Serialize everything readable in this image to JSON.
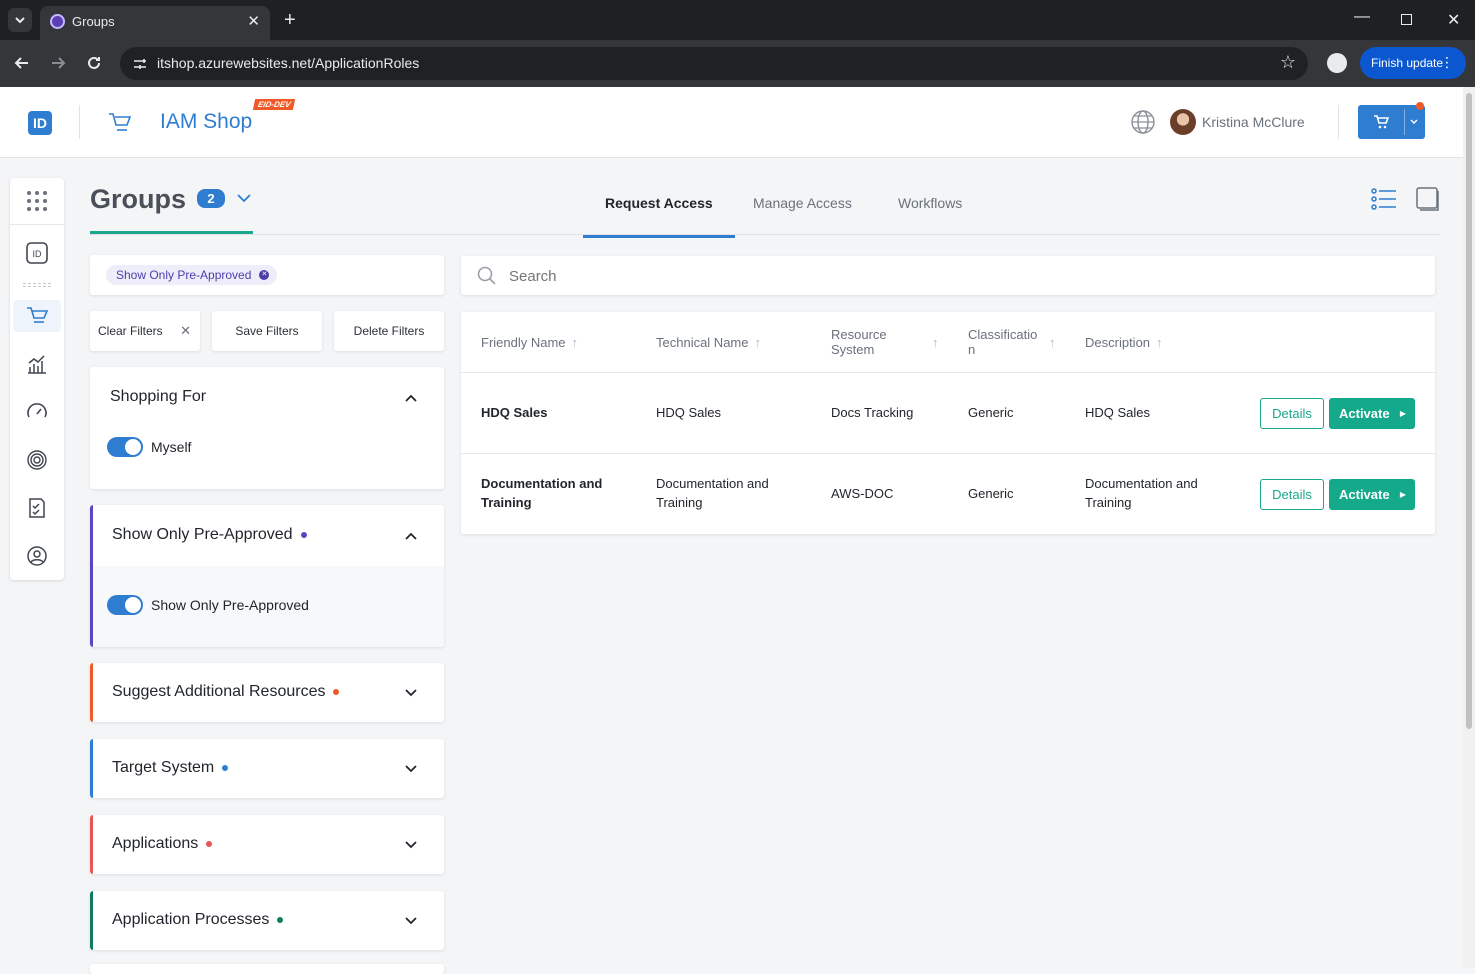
{
  "browser": {
    "tab_title": "Groups",
    "url": "itshop.azurewebsites.net/ApplicationRoles",
    "finish_update": "Finish update"
  },
  "header": {
    "logo_text": "ID",
    "app_name": "IAM Shop",
    "env_badge": "EID-DEV",
    "user_name": "Kristina McClure"
  },
  "page": {
    "title": "Groups",
    "count": "2",
    "tabs": [
      {
        "label": "Request Access",
        "active": true
      },
      {
        "label": "Manage Access",
        "active": false
      },
      {
        "label": "Workflows",
        "active": false
      }
    ]
  },
  "filters": {
    "active_chip": "Show Only Pre-Approved",
    "clear_label": "Clear Filters",
    "save_label": "Save Filters",
    "delete_label": "Delete Filters",
    "shopping_for": {
      "title": "Shopping For",
      "toggle_label": "Myself"
    },
    "pre_approved": {
      "title": "Show Only Pre-Approved",
      "toggle_label": "Show Only Pre-Approved",
      "color": "#5a45c2"
    },
    "suggest": {
      "title": "Suggest Additional Resources",
      "color": "#f05a28"
    },
    "target_system": {
      "title": "Target System",
      "color": "#2f7dd1"
    },
    "applications": {
      "title": "Applications",
      "color": "#e85555"
    },
    "app_processes": {
      "title": "Application Processes",
      "color": "#127a5c"
    }
  },
  "search": {
    "placeholder": "Search"
  },
  "table": {
    "headers": [
      "Friendly Name",
      "Technical Name",
      "Resource System",
      "Classification",
      "Description"
    ],
    "header_wrapped": {
      "resource": [
        "Resource",
        "System"
      ],
      "classification": [
        "Classificatio",
        "n"
      ]
    },
    "details_label": "Details",
    "activate_label": "Activate",
    "rows": [
      {
        "friendly": [
          "HDQ Sales"
        ],
        "technical": [
          "HDQ Sales"
        ],
        "system": "Docs Tracking",
        "classification": "Generic",
        "description": [
          "HDQ Sales"
        ]
      },
      {
        "friendly": [
          "Documentation and",
          "Training"
        ],
        "technical": [
          "Documentation and",
          "Training"
        ],
        "system": "AWS-DOC",
        "classification": "Generic",
        "description": [
          "Documentation and",
          "Training"
        ]
      }
    ]
  },
  "colors": {
    "primary": "#2f7dd1",
    "accent_green": "#13a98a",
    "teal_underline": "#1ba88a"
  }
}
